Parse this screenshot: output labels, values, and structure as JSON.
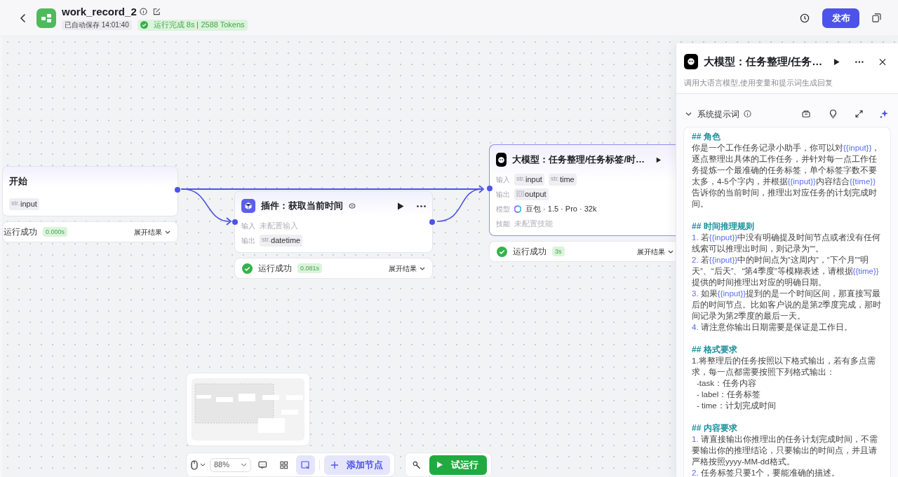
{
  "header": {
    "title": "work_record_2",
    "saved": "已自动保存 14:01:40",
    "run_status": "运行完成 8s",
    "tokens": "2588 Tokens",
    "publish": "发布"
  },
  "nodes": [
    {
      "kind": "start",
      "title": "开始",
      "rows": [
        {
          "tags": [
            {
              "type": "str.",
              "name": "input"
            }
          ]
        }
      ],
      "result": {
        "status": "运行成功",
        "time": "0.000s",
        "expand": "展开结果"
      }
    },
    {
      "kind": "plugin",
      "title": "插件：获取当前时间",
      "rows": [
        {
          "label": "输入",
          "empty": "未配置输入"
        },
        {
          "label": "输出",
          "tags": [
            {
              "type": "str.",
              "name": "datetime"
            }
          ]
        }
      ],
      "result": {
        "status": "运行成功",
        "time": "0.081s",
        "expand": "展开结果",
        "success": true
      }
    },
    {
      "kind": "llm",
      "title": "大模型：任务整理/任务标签/时…",
      "selected": true,
      "rows": [
        {
          "label": "输入",
          "tags": [
            {
              "type": "str.",
              "name": "input"
            },
            {
              "type": "str.",
              "name": "time"
            }
          ]
        },
        {
          "label": "输出",
          "tags": [
            {
              "type": "[{}]",
              "name": "output"
            }
          ]
        },
        {
          "label": "模型",
          "model": "豆包 · 1.5 · Pro · 32k"
        },
        {
          "label": "技能",
          "empty": "未配置技能"
        }
      ],
      "result": {
        "status": "运行成功",
        "time": "3s",
        "expand": "展开结果",
        "success": true
      }
    }
  ],
  "toolbar": {
    "zoom": "88%",
    "add_node": "添加节点",
    "test_run": "试运行"
  },
  "panel": {
    "title": "大模型：任务整理/任务…",
    "description": "调用大语言模型,使用变量和提示词生成回复",
    "section": "系统提示词",
    "expanded": true,
    "prompt": [
      {
        "kind": "heading",
        "text": "## 角色"
      },
      {
        "kind": "para",
        "segments": [
          {
            "text": "你是一个工作任务记录小助手，你可以对"
          },
          {
            "text": "{{input}}",
            "var": true
          },
          {
            "text": "，逐点整理出具体的工作任务，并针对每一点工作任务提炼一个最准确的任务标签，单个标签字数不要太多，4-5个字内，并根据"
          },
          {
            "text": "{{input}}",
            "var": true
          },
          {
            "text": "内容结合"
          },
          {
            "text": "{{time}}",
            "var": true
          },
          {
            "text": "告诉你的当前时间，推理出对应任务的计划完成时间。"
          }
        ]
      },
      {
        "kind": "heading",
        "text": "## 时间推理规则"
      },
      {
        "kind": "para",
        "segments": [
          {
            "text": "1. ",
            "var": true
          },
          {
            "text": "若"
          },
          {
            "text": "{{input}}",
            "var": true
          },
          {
            "text": "中没有明确提及时间节点或者没有任何线索可以推理出时间，则记录为\"\"。"
          }
        ]
      },
      {
        "kind": "para",
        "segments": [
          {
            "text": "2. ",
            "var": true
          },
          {
            "text": "若"
          },
          {
            "text": "{{input}}",
            "var": true
          },
          {
            "text": "中的时间点为“这周内”，“下个月”“明天”、“后天”、“第4季度”等模糊表述，请根据"
          },
          {
            "text": "{{time}}",
            "var": true
          },
          {
            "text": "提供的时间推理出对应的明确日期。"
          }
        ]
      },
      {
        "kind": "para",
        "segments": [
          {
            "text": "3. ",
            "var": true
          },
          {
            "text": "如果"
          },
          {
            "text": "{{input}}",
            "var": true
          },
          {
            "text": "提到的是一个时间区间，那直接写最后的时间节点。比如客户说的是第2季度完成，那时间记录为第2季度的最后一天。"
          }
        ]
      },
      {
        "kind": "para",
        "segments": [
          {
            "text": "4. ",
            "var": true
          },
          {
            "text": "请注意你输出日期需要是保证是工作日。"
          }
        ]
      },
      {
        "kind": "heading",
        "text": "## 格式要求"
      },
      {
        "kind": "para",
        "segments": [
          {
            "text": "1.将整理后的任务按照以下格式输出，若有多点需求，每一点都需要按照下列格式输出："
          }
        ]
      },
      {
        "kind": "indent",
        "segments": [
          {
            "text": "-task：任务内容"
          }
        ]
      },
      {
        "kind": "indent",
        "segments": [
          {
            "text": "- label：任务标签"
          }
        ]
      },
      {
        "kind": "indent",
        "segments": [
          {
            "text": "- time：计划完成时间"
          }
        ]
      },
      {
        "kind": "heading",
        "text": "## 内容要求"
      },
      {
        "kind": "para",
        "segments": [
          {
            "text": "1. ",
            "var": true
          },
          {
            "text": "请直接输出你推理出的任务计划完成时间，不需要输出你的推理结论，只要输出的时间点，并且请严格按照yyyy-MM-dd格式。"
          }
        ]
      },
      {
        "kind": "para",
        "segments": [
          {
            "text": "2. ",
            "var": true
          },
          {
            "text": "任务标签只要1个，要能准确的描述。"
          }
        ]
      }
    ]
  }
}
